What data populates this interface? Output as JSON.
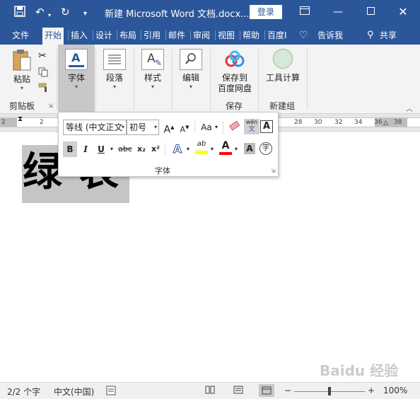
{
  "titlebar": {
    "title": "新建 Microsoft Word 文档.docx...",
    "login": "登录",
    "save_icon": "save-icon",
    "undo_icon": "undo-icon",
    "redo_icon": "redo-icon",
    "customize_icon": "customize-icon"
  },
  "tabs": [
    {
      "label": "文件"
    },
    {
      "label": "开始"
    },
    {
      "label": "插入"
    },
    {
      "label": "设计"
    },
    {
      "label": "布局"
    },
    {
      "label": "引用"
    },
    {
      "label": "邮件"
    },
    {
      "label": "审阅"
    },
    {
      "label": "视图"
    },
    {
      "label": "帮助"
    },
    {
      "label": "百度I"
    }
  ],
  "tell_me": "告诉我",
  "share": "共享",
  "ribbon": {
    "paste": "粘贴",
    "clipboard": "剪贴板",
    "font": "字体",
    "paragraph": "段落",
    "styles": "样式",
    "editing": "编辑",
    "save_baidu_1": "保存到",
    "save_baidu_2": "百度网盘",
    "save_group": "保存",
    "calc": "工具计算",
    "new_group": "新建组"
  },
  "ruler": {
    "left": [
      "2",
      "2"
    ],
    "right": [
      "28",
      "30",
      "32",
      "34",
      "36",
      "38"
    ]
  },
  "document": {
    "char1": "绿",
    "char2": "表"
  },
  "mini_font": {
    "font_name": "等线 (中文正文",
    "font_size": "初号",
    "label": "字体",
    "bold": "B",
    "italic": "I",
    "underline": "U",
    "strike": "abc",
    "sub": "x₂",
    "sup": "x²",
    "case": "Aa",
    "grow": "A",
    "shrink": "A",
    "phonetic": "wén",
    "phonetic_char": "文",
    "boxed": "A",
    "effects": "A",
    "highlight": "ab",
    "color": "A",
    "shade": "A",
    "enclosed": "字",
    "highlight_color": "#ffff00",
    "font_color": "#ff0000"
  },
  "status": {
    "pages": "2/2 个字",
    "lang": "中文(中国)",
    "zoom": "100%",
    "minus": "−",
    "plus": "+"
  },
  "watermark": "Baidu 经验"
}
